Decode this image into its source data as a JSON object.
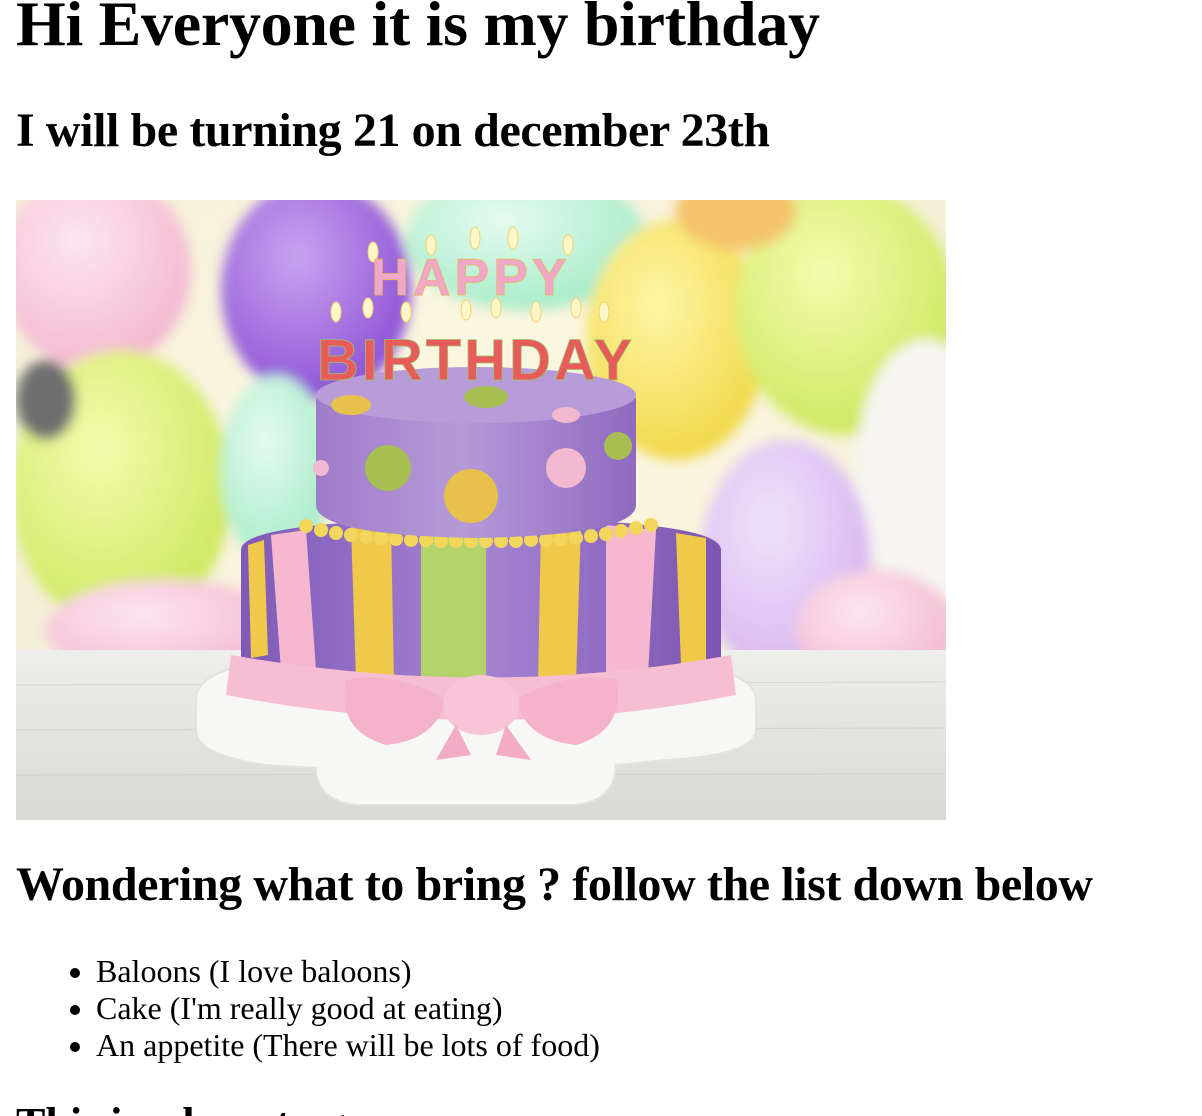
{
  "page": {
    "title": "Hi Everyone it is my birthday",
    "subtitle": "I will be turning 21 on december 23th",
    "section_title": "Wondering what to bring ? follow the list down below",
    "next_heading": "This is where to go",
    "photo": {
      "alt": "Birthday cake with HAPPY BIRTHDAY candles",
      "candle_line_1": "HAPPY",
      "candle_line_2": "BIRTHDAY"
    },
    "bring_list": [
      "Baloons (I love baloons)",
      "Cake (I'm really good at eating)",
      "An appetite (There will be lots of food)"
    ]
  },
  "colors": {
    "text": "#000000",
    "background": "#ffffff"
  }
}
